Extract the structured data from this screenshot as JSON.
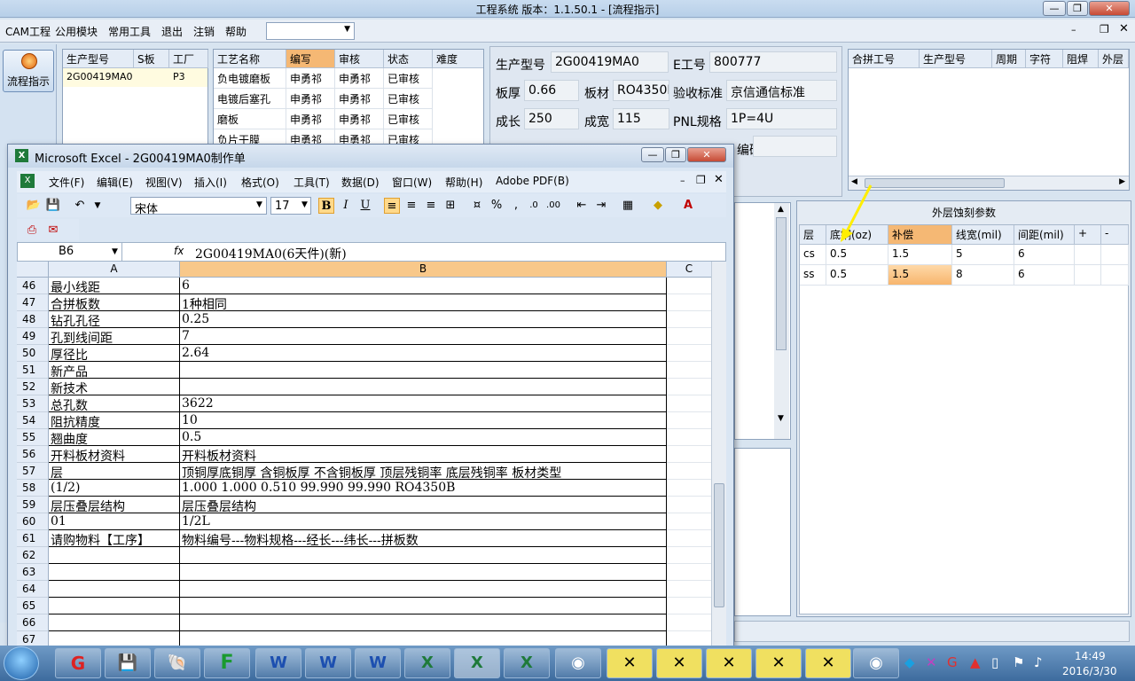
{
  "app": {
    "title": "工程系统   版本：1.1.50.1 - [流程指示]",
    "menu": [
      "CAM工程",
      "公用模块",
      "常用工具",
      "退出",
      "注销",
      "帮助"
    ],
    "nav_button": "流程指示"
  },
  "order_list": {
    "headers": [
      "生产型号",
      "S板",
      "工厂"
    ],
    "rows": [
      [
        "2G00419MA0",
        "",
        "P3"
      ]
    ]
  },
  "process_table": {
    "headers": [
      "工艺名称",
      "编写",
      "审核",
      "状态",
      "难度"
    ],
    "rows": [
      [
        "负电镀磨板",
        "申勇祁",
        "申勇祁",
        "已审核",
        ""
      ],
      [
        "电镀后塞孔",
        "申勇祁",
        "申勇祁",
        "已审核",
        ""
      ],
      [
        "磨板",
        "申勇祁",
        "申勇祁",
        "已审核",
        ""
      ],
      [
        "负片干膜",
        "申勇祁",
        "申勇祁",
        "已审核",
        ""
      ]
    ]
  },
  "info": {
    "model_label": "生产型号",
    "model_value": "2G00419MA0",
    "eno_label": "E工号",
    "eno_value": "800777",
    "thick_label": "板厚",
    "thick_value": "0.66",
    "material_label": "板材",
    "material_value": "RO4350B",
    "standard_label": "验收标准",
    "standard_value": "京信通信标准",
    "length_label": "成长",
    "length_value": "250",
    "width_label": "成宽",
    "width_value": "115",
    "pnl_label": "PNL规格",
    "pnl_value": "1P=4U",
    "code_label": "编码"
  },
  "merge_table": {
    "headers": [
      "合拼工号",
      "生产型号",
      "周期",
      "字符",
      "阻焊",
      "外层"
    ]
  },
  "etch_params": {
    "title": "外层蚀刻参数",
    "headers": [
      "层",
      "底铜(oz)",
      "补偿",
      "线宽(mil)",
      "间距(mil)",
      "+",
      "-"
    ],
    "rows": [
      [
        "cs",
        "0.5",
        "1.5",
        "5",
        "6"
      ],
      [
        "ss",
        "0.5",
        "1.5",
        "8",
        "6"
      ]
    ]
  },
  "excel": {
    "title": "Microsoft Excel - 2G00419MA0制作单",
    "menu": [
      "文件(F)",
      "编辑(E)",
      "视图(V)",
      "插入(I)",
      "格式(O)",
      "工具(T)",
      "数据(D)",
      "窗口(W)",
      "帮助(H)",
      "Adobe PDF(B)"
    ],
    "font_name": "宋体",
    "font_size": "17",
    "name_box": "B6",
    "fx": "fx",
    "formula": "2G00419MA0(6天件)(新)",
    "columns": [
      "A",
      "B",
      "C"
    ],
    "rows": [
      {
        "n": "46",
        "a": "最小线距",
        "b": "6"
      },
      {
        "n": "47",
        "a": "合拼板数",
        "b": "1种相同"
      },
      {
        "n": "48",
        "a": "钻孔孔径",
        "b": "0.25"
      },
      {
        "n": "49",
        "a": "孔到线间距",
        "b": "7"
      },
      {
        "n": "50",
        "a": "厚径比",
        "b": "2.64"
      },
      {
        "n": "51",
        "a": "新产品",
        "b": ""
      },
      {
        "n": "52",
        "a": "新技术",
        "b": ""
      },
      {
        "n": "53",
        "a": "总孔数",
        "b": "3622"
      },
      {
        "n": "54",
        "a": "阻抗精度",
        "b": "10"
      },
      {
        "n": "55",
        "a": "翘曲度",
        "b": "0.5"
      },
      {
        "n": "56",
        "a": "开料板材资料",
        "b": "开料板材资料"
      },
      {
        "n": "57",
        "a": "层",
        "b": "顶铜厚底铜厚 含铜板厚 不含铜板厚 顶层残铜率 底层残铜率 板材类型"
      },
      {
        "n": "58",
        "a": "(1/2)",
        "b": "1.000  1.000          0.510       99.990     99.990       RO4350B"
      },
      {
        "n": "59",
        "a": "层压叠层结构",
        "b": "层压叠层结构"
      },
      {
        "n": "60",
        "a": "01",
        "b": "1/2L"
      },
      {
        "n": "61",
        "a": "请购物料【工序】",
        "b": "物料编号---物料规格---经长---纬长---拼板数"
      },
      {
        "n": "62",
        "a": "",
        "b": ""
      },
      {
        "n": "63",
        "a": "",
        "b": ""
      },
      {
        "n": "64",
        "a": "",
        "b": ""
      },
      {
        "n": "65",
        "a": "",
        "b": ""
      },
      {
        "n": "66",
        "a": "",
        "b": ""
      },
      {
        "n": "67",
        "a": "",
        "b": ""
      }
    ]
  },
  "taskbar": {
    "time": "14:49",
    "date": "2016/3/30"
  }
}
